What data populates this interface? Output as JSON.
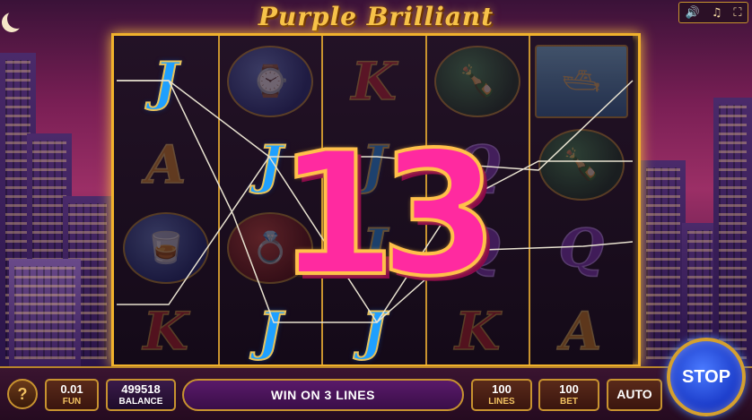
{
  "game": {
    "title": "Purple Brilliant"
  },
  "top_controls": {
    "volume_icon": "speaker-icon",
    "music_icon": "music-note-icon",
    "fullscreen_icon": "fullscreen-icon"
  },
  "reels": [
    [
      "J",
      "A",
      "cognac",
      "K"
    ],
    [
      "watch",
      "J",
      "ring",
      "J"
    ],
    [
      "K",
      "J",
      "J",
      "J"
    ],
    [
      "champagne",
      "Q",
      "Q",
      "K"
    ],
    [
      "yacht",
      "champagne",
      "Q",
      "A"
    ]
  ],
  "win_display": {
    "amount": "13"
  },
  "bottom_bar": {
    "help_label": "?",
    "fun_value": "0.01",
    "fun_label": "FUN",
    "balance_value": "499518",
    "balance_label": "BALANCE",
    "message": "WIN ON 3 LINES",
    "lines_value": "100",
    "lines_label": "LINES",
    "bet_value": "100",
    "bet_label": "BET",
    "auto_label": "AUTO",
    "stop_label": "STOP"
  },
  "colors": {
    "frame_gold": "#f0b12c",
    "win_pink": "#ff2aa0",
    "stop_blue": "#1a3ac8"
  }
}
